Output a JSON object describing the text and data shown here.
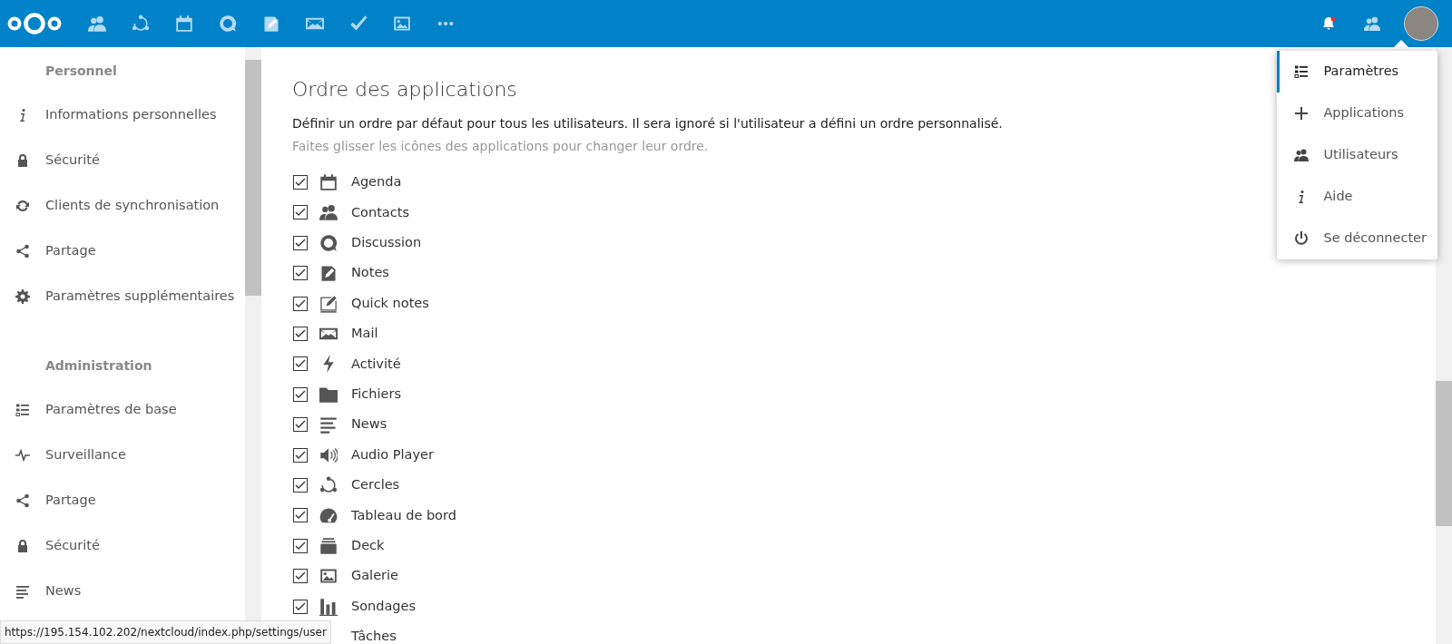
{
  "header": {
    "notification_unread": true
  },
  "sidebar": {
    "sections": [
      {
        "heading": "Personnel",
        "items": [
          {
            "label": "Informations personnelles",
            "selected": false
          },
          {
            "label": "Sécurité",
            "selected": false
          },
          {
            "label": "Clients de synchronisation",
            "selected": false
          },
          {
            "label": "Partage",
            "selected": false
          },
          {
            "label": "Paramètres supplémentaires",
            "selected": false
          }
        ]
      },
      {
        "heading": "Administration",
        "items": [
          {
            "label": "Paramètres de base",
            "selected": false
          },
          {
            "label": "Surveillance",
            "selected": false
          },
          {
            "label": "Partage",
            "selected": false
          },
          {
            "label": "Sécurité",
            "selected": false
          },
          {
            "label": "News",
            "selected": false
          }
        ]
      }
    ]
  },
  "content": {
    "title": "Ordre des applications",
    "description": "Définir un ordre par défaut pour tous les utilisateurs. Il sera ignoré si l'utilisateur a défini un ordre personnalisé.",
    "hint": "Faites glisser les icônes des applications pour changer leur ordre.",
    "apps": [
      {
        "label": "Agenda",
        "checked": true
      },
      {
        "label": "Contacts",
        "checked": true
      },
      {
        "label": "Discussion",
        "checked": true
      },
      {
        "label": "Notes",
        "checked": true
      },
      {
        "label": "Quick notes",
        "checked": true
      },
      {
        "label": "Mail",
        "checked": true
      },
      {
        "label": "Activité",
        "checked": true
      },
      {
        "label": "Fichiers",
        "checked": true
      },
      {
        "label": "News",
        "checked": true
      },
      {
        "label": "Audio Player",
        "checked": true
      },
      {
        "label": "Cercles",
        "checked": true
      },
      {
        "label": "Tableau de bord",
        "checked": true
      },
      {
        "label": "Deck",
        "checked": true
      },
      {
        "label": "Galerie",
        "checked": true
      },
      {
        "label": "Sondages",
        "checked": true
      },
      {
        "label": "Tâches"
      }
    ]
  },
  "user_menu": {
    "items": [
      {
        "label": "Paramètres",
        "selected": true
      },
      {
        "label": "Applications",
        "selected": false
      },
      {
        "label": "Utilisateurs",
        "selected": false
      },
      {
        "label": "Aide",
        "selected": false
      },
      {
        "label": "Se déconnecter",
        "selected": false
      }
    ]
  },
  "status_url": "https://195.154.102.202/nextcloud/index.php/settings/user"
}
